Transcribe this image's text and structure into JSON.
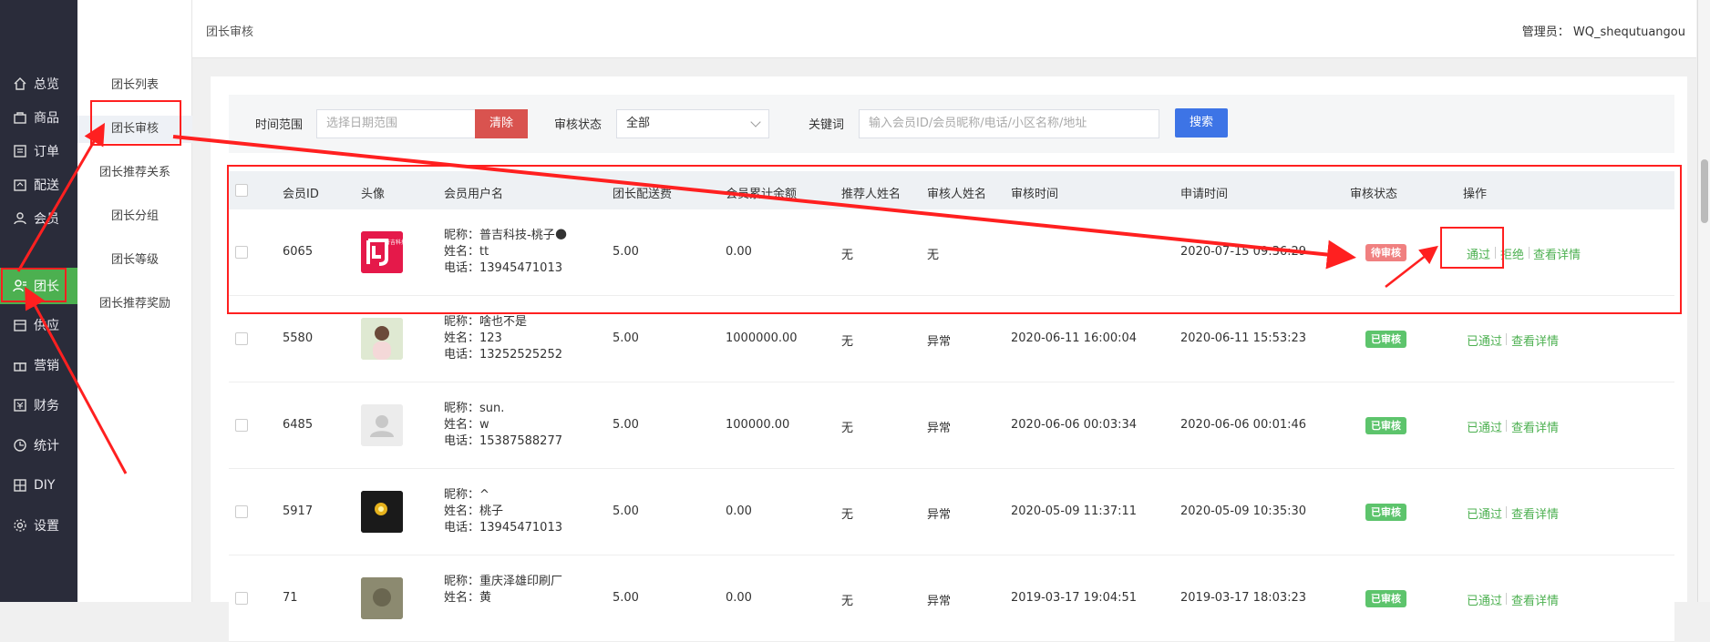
{
  "nav": {
    "items": [
      {
        "label": "总览",
        "icon": "home-icon"
      },
      {
        "label": "商品",
        "icon": "goods-icon"
      },
      {
        "label": "订单",
        "icon": "order-icon"
      },
      {
        "label": "配送",
        "icon": "delivery-icon"
      },
      {
        "label": "会员",
        "icon": "member-icon"
      },
      {
        "label": "团长",
        "icon": "leader-icon"
      },
      {
        "label": "供应",
        "icon": "supply-icon"
      },
      {
        "label": "营销",
        "icon": "gift-icon"
      },
      {
        "label": "财务",
        "icon": "finance-icon"
      },
      {
        "label": "统计",
        "icon": "stats-icon"
      },
      {
        "label": "DIY",
        "icon": "diy-icon"
      },
      {
        "label": "设置",
        "icon": "settings-icon"
      }
    ],
    "active_index": 5
  },
  "subnav": {
    "items": [
      "团长列表",
      "团长审核",
      "团长推荐关系",
      "团长分组",
      "团长等级",
      "团长推荐奖励"
    ],
    "active_index": 1
  },
  "header": {
    "breadcrumb": "团长审核",
    "admin": "管理员： WQ_shequtuangou"
  },
  "filter": {
    "time_label": "时间范围",
    "date_placeholder": "选择日期范围",
    "clear_label": "清除",
    "status_label": "审核状态",
    "status_value": "全部",
    "keyword_label": "关键词",
    "keyword_placeholder": "输入会员ID/会员昵称/电话/小区名称/地址",
    "search_label": "搜索"
  },
  "table": {
    "headers": [
      "会员ID",
      "头像",
      "会员用户名",
      "团长配送费",
      "会员累计余额",
      "推荐人姓名",
      "审核人姓名",
      "审核时间",
      "申请时间",
      "审核状态",
      "操作"
    ],
    "rows": [
      {
        "id": "6065",
        "avatar": "logo-red",
        "nick": "昵称：普吉科技-桃子🌑",
        "name": "姓名：tt",
        "phone": "电话：13945471013",
        "fee": "5.00",
        "balance": "0.00",
        "referrer": "无",
        "reviewer": "无",
        "review_time": "",
        "apply_time": "2020-07-15 09:36:29",
        "status": "待审核",
        "status_type": "pending",
        "ops": [
          "通过",
          "拒绝",
          "查看详情"
        ]
      },
      {
        "id": "5580",
        "avatar": "photo-girl",
        "nick": "昵称：啥也不是",
        "name": "姓名：123",
        "phone": "电话：13252525252",
        "fee": "5.00",
        "balance": "1000000.00",
        "referrer": "无",
        "reviewer": "异常",
        "review_time": "2020-06-11 16:00:04",
        "apply_time": "2020-06-11 15:53:23",
        "status": "已审核",
        "status_type": "ok",
        "ops": [
          "已通过",
          "查看详情"
        ]
      },
      {
        "id": "6485",
        "avatar": "default-user",
        "nick": "昵称：sun.",
        "name": "姓名：w",
        "phone": "电话：15387588277",
        "fee": "5.00",
        "balance": "100000.00",
        "referrer": "无",
        "reviewer": "异常",
        "review_time": "2020-06-06 00:03:34",
        "apply_time": "2020-06-06 00:01:46",
        "status": "已审核",
        "status_type": "ok",
        "ops": [
          "已通过",
          "查看详情"
        ]
      },
      {
        "id": "5917",
        "avatar": "photo-dark",
        "nick": "昵称：^",
        "name": "姓名：桃子",
        "phone": "电话：13945471013",
        "fee": "5.00",
        "balance": "0.00",
        "referrer": "无",
        "reviewer": "异常",
        "review_time": "2020-05-09 11:37:11",
        "apply_time": "2020-05-09 10:35:30",
        "status": "已审核",
        "status_type": "ok",
        "ops": [
          "已通过",
          "查看详情"
        ]
      },
      {
        "id": "71",
        "avatar": "photo-cat",
        "nick": "昵称：重庆泽雄印刷厂",
        "name": "姓名：黄",
        "phone": "",
        "fee": "5.00",
        "balance": "0.00",
        "referrer": "无",
        "reviewer": "异常",
        "review_time": "2019-03-17 19:04:51",
        "apply_time": "2019-03-17 18:03:23",
        "status": "已审核",
        "status_type": "ok",
        "ops": [
          "已通过",
          "查看详情"
        ]
      }
    ]
  },
  "logo_text": "普吉科技"
}
